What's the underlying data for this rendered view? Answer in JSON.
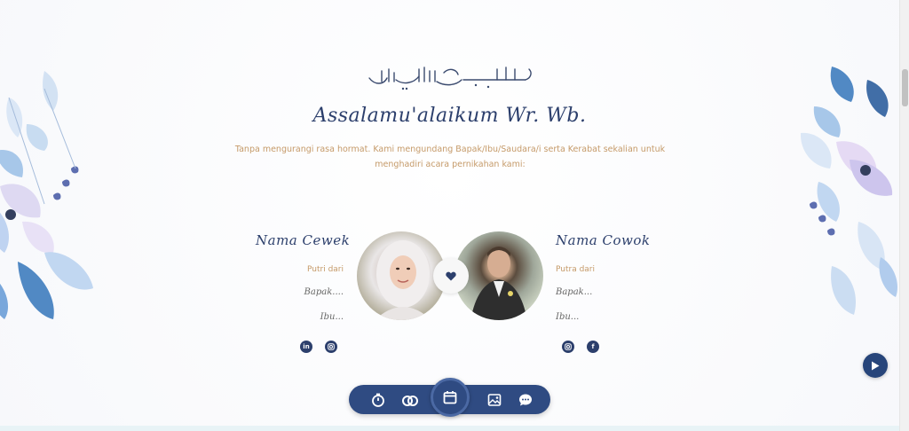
{
  "header": {
    "salam": "Assalamu'alaikum Wr. Wb.",
    "intro": "Tanpa mengurangi rasa hormat. Kami mengundang Bapak/Ibu/Saudara/i serta Kerabat sekalian untuk menghadiri acara pernikahan kami:"
  },
  "bride": {
    "name": "Nama Cewek",
    "relation": "Putri dari",
    "father": "Bapak....",
    "mother": "Ibu..."
  },
  "groom": {
    "name": "Nama Cowok",
    "relation": "Putra dari",
    "father": "Bapak...",
    "mother": "Ibu..."
  },
  "bride_social": [
    "linkedin-icon",
    "instagram-icon"
  ],
  "groom_social": [
    "instagram-icon",
    "facebook-icon"
  ],
  "social_glyphs": {
    "linkedin": "in",
    "facebook": "f"
  },
  "navbar": {
    "items": [
      "timer-icon",
      "rings-icon",
      "calendar-icon",
      "gallery-icon",
      "chat-icon"
    ],
    "active": "calendar-icon"
  },
  "colors": {
    "navy": "#2c3f6c",
    "gold": "#c59a69",
    "nav_bg": "#2f4b82"
  }
}
